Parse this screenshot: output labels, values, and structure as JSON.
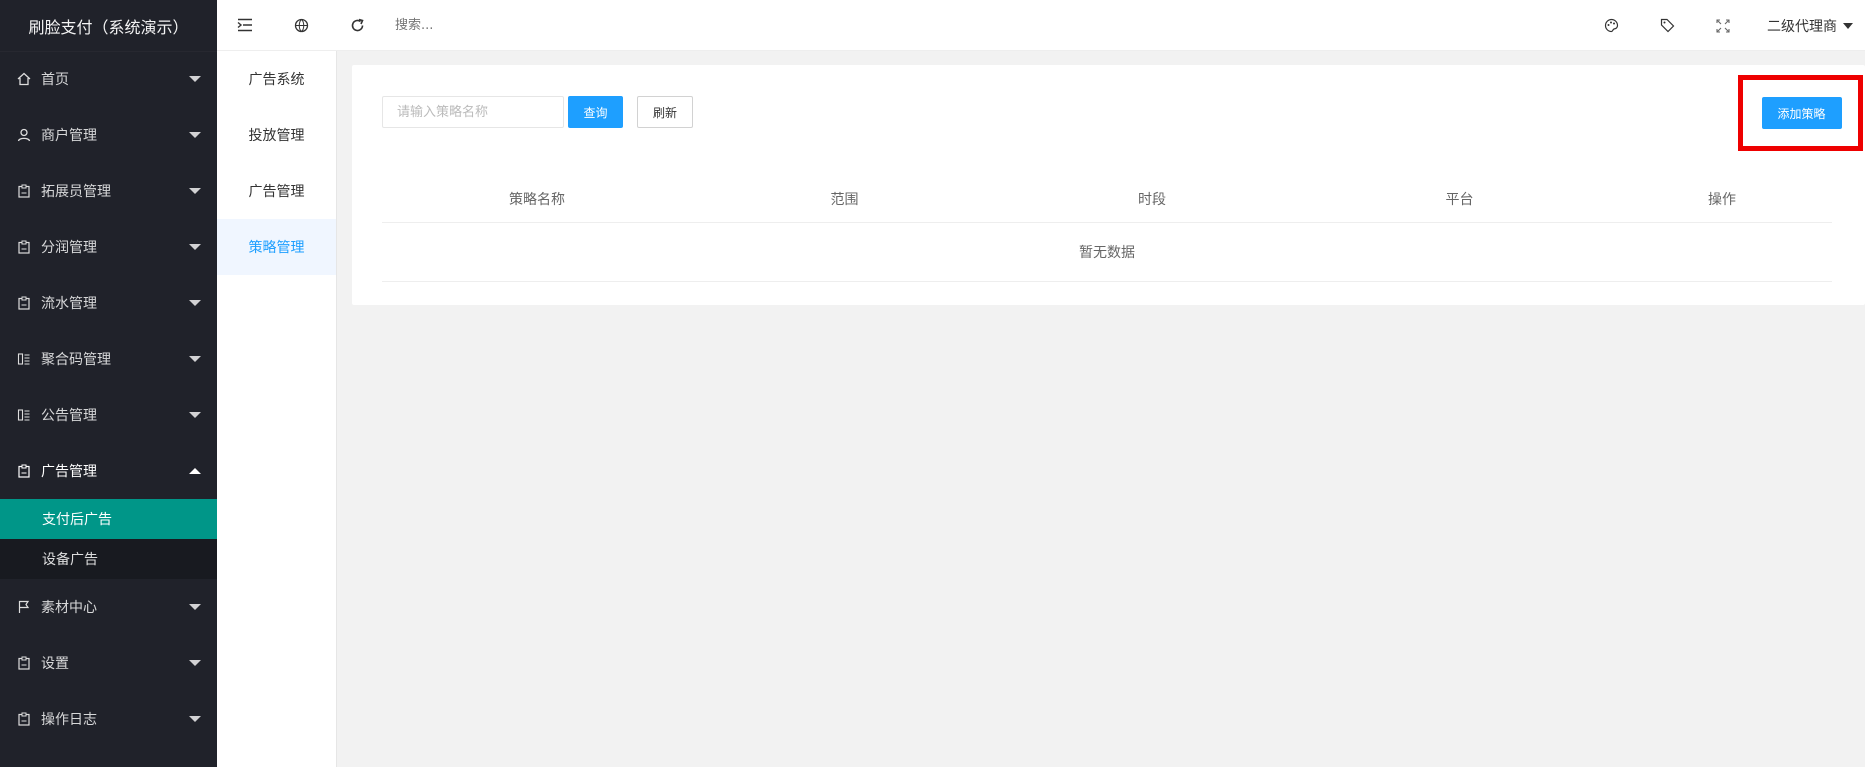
{
  "app": {
    "title": "刷脸支付（系统演示）"
  },
  "sidebar": {
    "items": [
      {
        "label": "首页",
        "icon": "home-icon"
      },
      {
        "label": "商户管理",
        "icon": "user-icon"
      },
      {
        "label": "拓展员管理",
        "icon": "clipboard-icon"
      },
      {
        "label": "分润管理",
        "icon": "clipboard-icon"
      },
      {
        "label": "流水管理",
        "icon": "clipboard-icon"
      },
      {
        "label": "聚合码管理",
        "icon": "list-icon"
      },
      {
        "label": "公告管理",
        "icon": "list-icon"
      },
      {
        "label": "广告管理",
        "icon": "clipboard-icon"
      },
      {
        "label": "素材中心",
        "icon": "flag-icon"
      },
      {
        "label": "设置",
        "icon": "clipboard-icon"
      },
      {
        "label": "操作日志",
        "icon": "clipboard-icon"
      }
    ],
    "ad_submenu": [
      {
        "label": "支付后广告"
      },
      {
        "label": "设备广告"
      }
    ]
  },
  "header": {
    "search_placeholder": "搜索...",
    "user_name": "二级代理商"
  },
  "subnav": {
    "items": [
      {
        "label": "广告系统"
      },
      {
        "label": "投放管理"
      },
      {
        "label": "广告管理"
      },
      {
        "label": "策略管理"
      }
    ]
  },
  "main": {
    "search_placeholder": "请输入策略名称",
    "query_label": "查询",
    "refresh_label": "刷新",
    "add_label": "添加策略",
    "columns": [
      "策略名称",
      "范围",
      "时段",
      "平台",
      "操作"
    ],
    "empty_text": "暂无数据"
  },
  "colors": {
    "sidebar_bg": "#20222a",
    "active_submenu": "#009688",
    "primary": "#1e9fff",
    "highlight_border": "#ee0000"
  }
}
